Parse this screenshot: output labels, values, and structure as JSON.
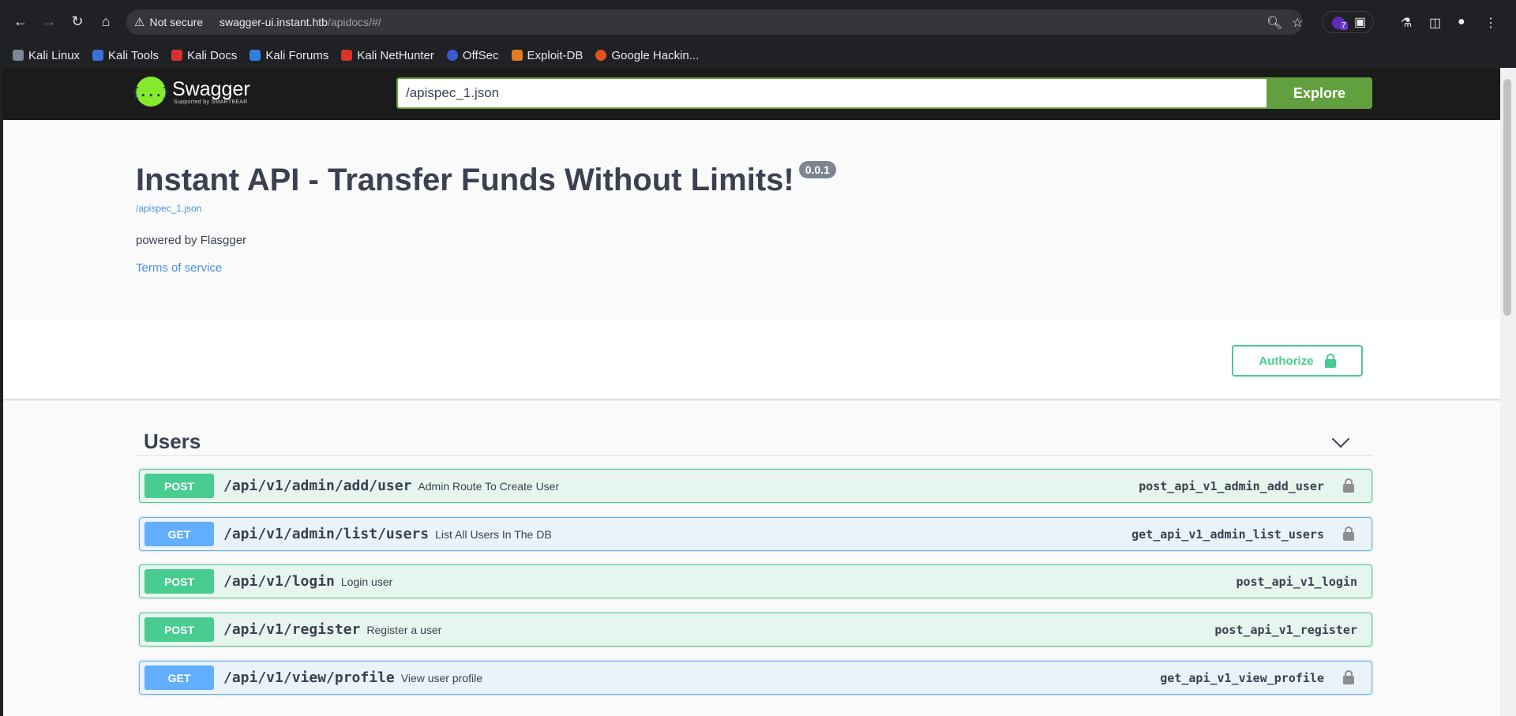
{
  "browser": {
    "security_label": "Not secure",
    "url_host": "swagger-ui.instant.htb",
    "url_path": "/apidocs/#/",
    "extension_badge": "7",
    "bookmarks": [
      "Kali Linux",
      "Kali Tools",
      "Kali Docs",
      "Kali Forums",
      "Kali NetHunter",
      "OffSec",
      "Exploit-DB",
      "Google Hackin..."
    ]
  },
  "swagger": {
    "logo_text": "Swagger",
    "logo_sub": "Supported by SMARTBEAR",
    "spec_url": "/apispec_1.json",
    "explore_label": "Explore"
  },
  "info": {
    "title": "Instant API - Transfer Funds Without Limits!",
    "version": "0.0.1",
    "spec_link": "/apispec_1.json",
    "powered_by": "powered by Flasgger",
    "terms": "Terms of service"
  },
  "authorize_label": "Authorize",
  "tag": {
    "name": "Users",
    "operations": [
      {
        "method": "POST",
        "path": "/api/v1/admin/add/user",
        "summary": "Admin Route To Create User",
        "op_id": "post_api_v1_admin_add_user",
        "locked": true
      },
      {
        "method": "GET",
        "path": "/api/v1/admin/list/users",
        "summary": "List All Users In The DB",
        "op_id": "get_api_v1_admin_list_users",
        "locked": true
      },
      {
        "method": "POST",
        "path": "/api/v1/login",
        "summary": "Login user",
        "op_id": "post_api_v1_login",
        "locked": false
      },
      {
        "method": "POST",
        "path": "/api/v1/register",
        "summary": "Register a user",
        "op_id": "post_api_v1_register",
        "locked": false
      },
      {
        "method": "GET",
        "path": "/api/v1/view/profile",
        "summary": "View user profile",
        "op_id": "get_api_v1_view_profile",
        "locked": true
      }
    ]
  },
  "colors": {
    "post": "#49cc90",
    "get": "#61affe",
    "explore": "#62a03f",
    "logo": "#85ea2d"
  }
}
